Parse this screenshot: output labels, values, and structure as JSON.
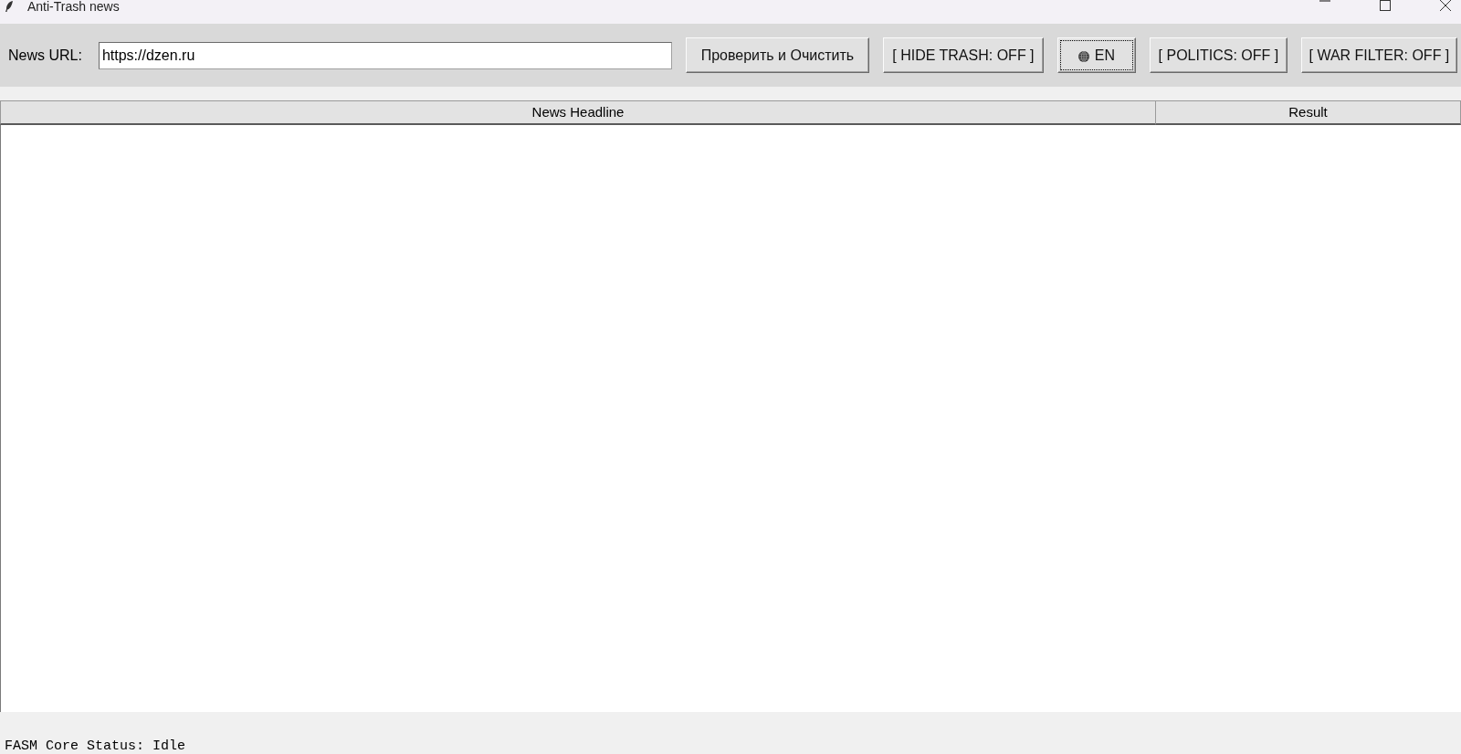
{
  "window": {
    "title": "Anti-Trash news"
  },
  "toolbar": {
    "url_label": "News URL:",
    "url_field": {
      "value": "https://dzen.ru"
    },
    "buttons": [
      {
        "kind": "text",
        "label": "Проверить и Очистить",
        "focused": false
      },
      {
        "kind": "text",
        "label": "[ HIDE TRASH: OFF ]",
        "focused": false
      },
      {
        "kind": "language",
        "label": "EN",
        "focused": true
      },
      {
        "kind": "text",
        "label": "[ POLITICS: OFF ]",
        "focused": false
      },
      {
        "kind": "text",
        "label": "[ WAR FILTER: OFF ]",
        "focused": false
      }
    ]
  },
  "table": {
    "columns": [
      "News Headline",
      "Result"
    ]
  },
  "status_bar": {
    "text": "FASM Core Status: Idle"
  }
}
